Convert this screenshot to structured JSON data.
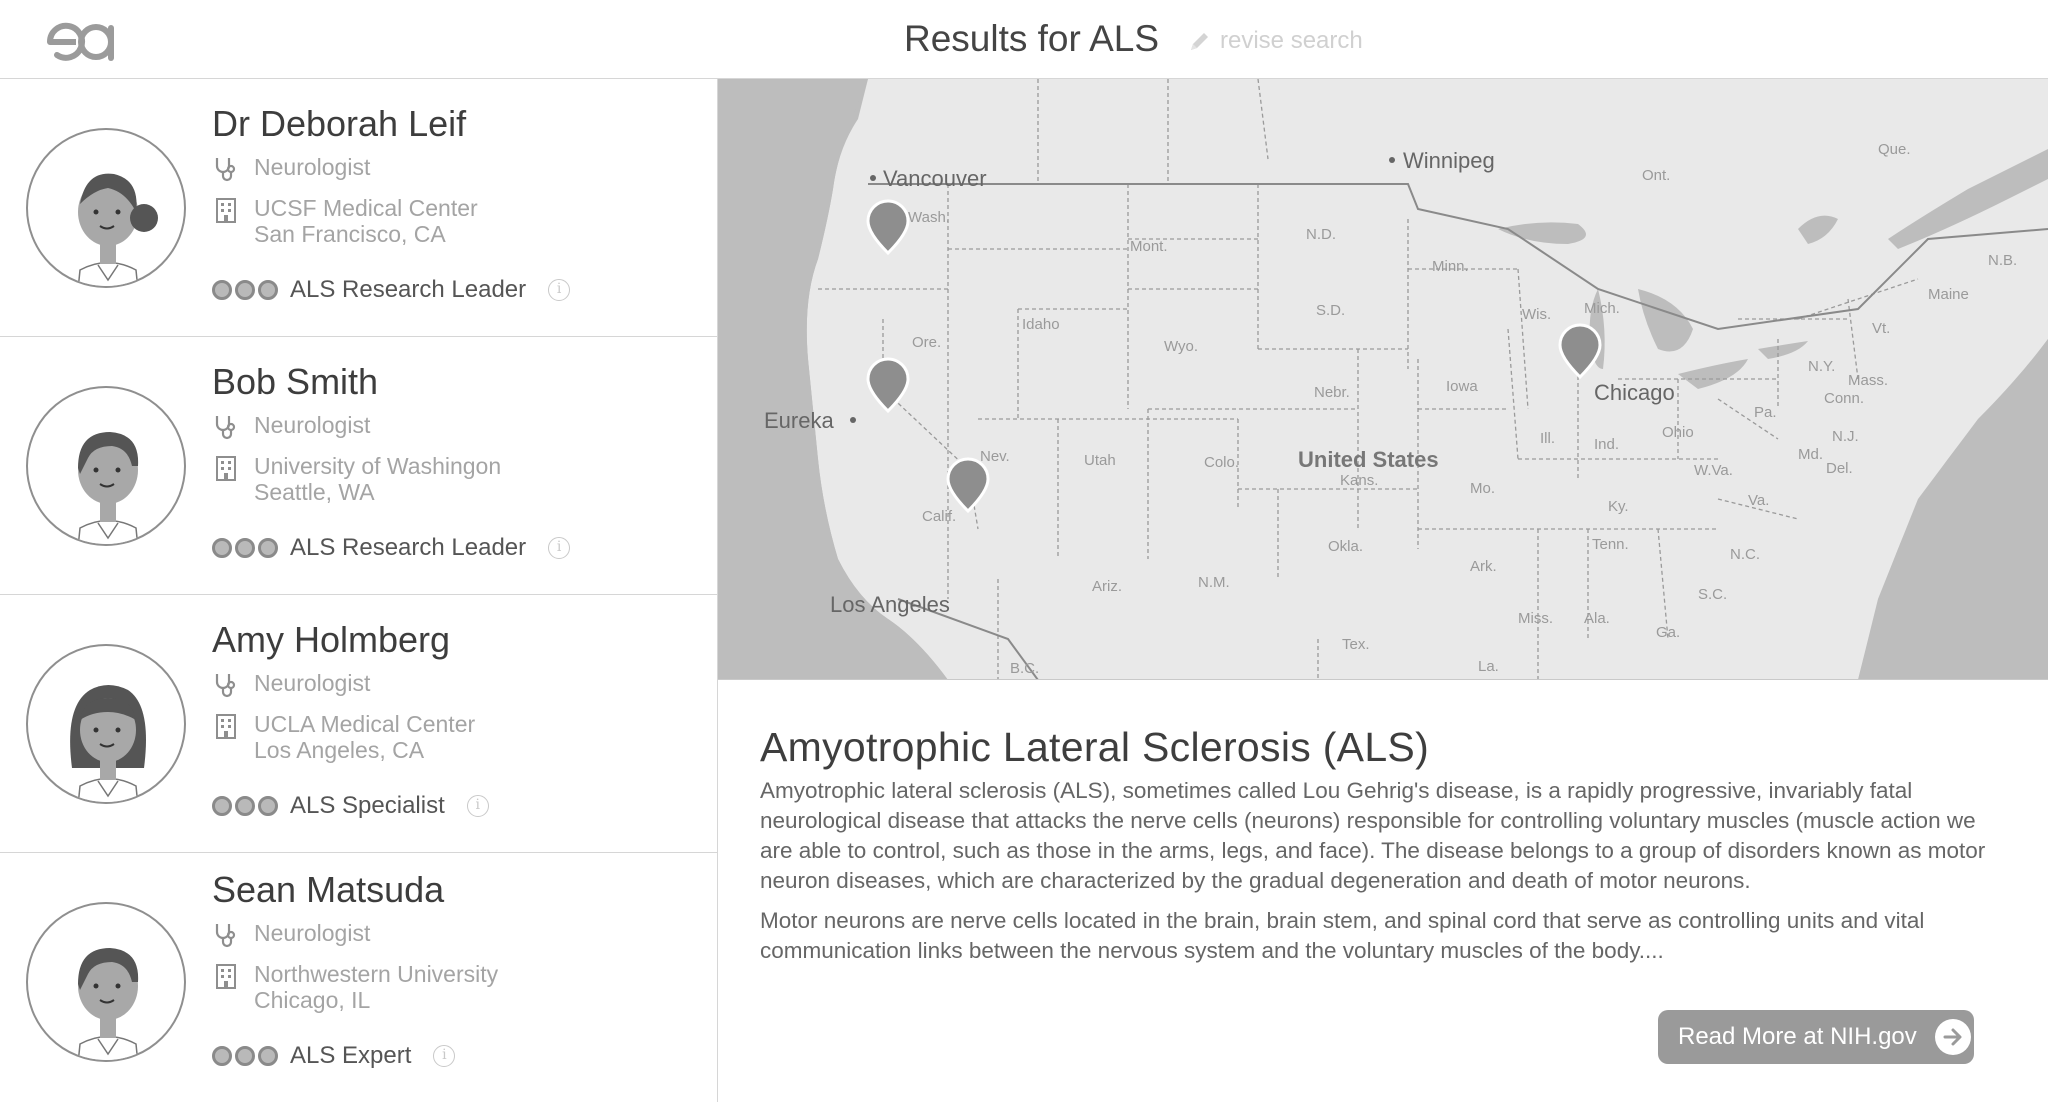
{
  "header": {
    "logo_alt": "ea",
    "title": "Results for ALS",
    "revise_label": "revise search"
  },
  "doctors": [
    {
      "name": "Dr Deborah Leif",
      "specialty": "Neurologist",
      "institution": "UCSF Medical Center",
      "location": "San Francisco, CA",
      "badge": "ALS Research Leader",
      "avatar": "female-ponytail"
    },
    {
      "name": "Bob Smith",
      "specialty": "Neurologist",
      "institution": "University of Washingon",
      "location": "Seattle, WA",
      "badge": "ALS Research Leader",
      "avatar": "male"
    },
    {
      "name": "Amy Holmberg",
      "specialty": "Neurologist",
      "institution": "UCLA Medical Center",
      "location": "Los Angeles, CA",
      "badge": "ALS Specialist",
      "avatar": "female-bob"
    },
    {
      "name": "Sean Matsuda",
      "specialty": "Neurologist",
      "institution": "Northwestern University",
      "location": "Chicago, IL",
      "badge": "ALS Expert",
      "avatar": "male"
    }
  ],
  "map": {
    "country": "United States",
    "cities": [
      "Vancouver",
      "Winnipeg",
      "Eureka",
      "Chicago",
      "Los Angeles"
    ],
    "states": [
      "Wash.",
      "Mont.",
      "N.D.",
      "Minn.",
      "Ont.",
      "Que.",
      "N.B.",
      "Maine",
      "Idaho",
      "Ore.",
      "S.D.",
      "Wyo.",
      "Wis.",
      "Mich.",
      "Nebr.",
      "Iowa",
      "N.Y.",
      "Mass.",
      "Conn.",
      "Nev.",
      "Utah",
      "Colo.",
      "Ill.",
      "Ind.",
      "Ohio",
      "Pa.",
      "N.J.",
      "Md.",
      "Del.",
      "W.Va.",
      "Va.",
      "Kans.",
      "Mo.",
      "Ky.",
      "Calif.",
      "Tenn.",
      "N.C.",
      "Okla.",
      "Ark.",
      "S.C.",
      "Ariz.",
      "N.M.",
      "Miss.",
      "Ala.",
      "Ga.",
      "Tex.",
      "La.",
      "B.C.",
      "Vt."
    ],
    "pins": [
      "Seattle",
      "San Francisco",
      "Los Angeles",
      "Chicago"
    ]
  },
  "article": {
    "title": "Amyotrophic  Lateral  Sclerosis (ALS)",
    "para1": "Amyotrophic lateral sclerosis (ALS), sometimes called Lou Gehrig's disease, is a rapidly progressive, invariably fatal neurological disease that attacks the nerve cells (neurons) responsible for controlling voluntary muscles (muscle action we are able to control, such as those in the arms, legs, and face). The disease belongs to a group of disorders known as motor neuron diseases, which are characterized by the gradual degeneration and death of motor neurons.",
    "para2": "Motor neurons are nerve cells located in the brain, brain stem, and spinal cord that serve as controlling units and vital communication links between the nervous system and the voluntary muscles of the body....",
    "read_more": "Read More at NIH.gov"
  }
}
